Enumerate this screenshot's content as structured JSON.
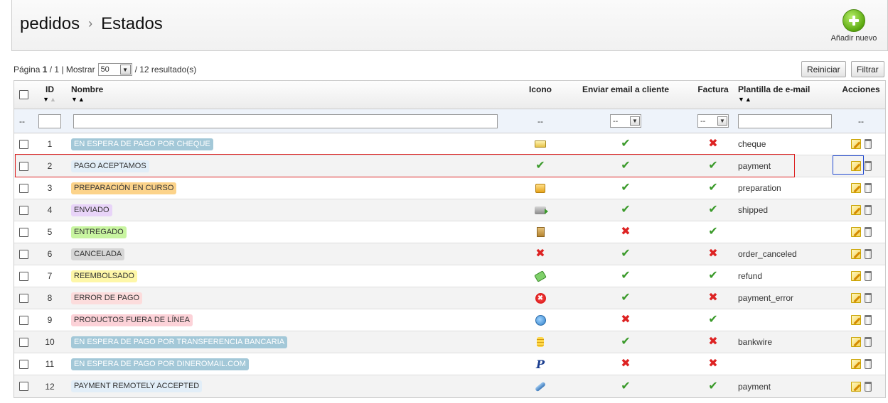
{
  "header": {
    "breadcrumb_root": "pedidos",
    "breadcrumb_sep": "›",
    "breadcrumb_current": "Estados",
    "add_new_label": "Añadir nuevo"
  },
  "pager": {
    "page_label": "Página",
    "page_current": "1",
    "page_total": "/ 1",
    "show_label": "| Mostrar",
    "per_page": "50",
    "results": "/ 12 resultado(s)"
  },
  "buttons": {
    "reset": "Reiniciar",
    "filter": "Filtrar"
  },
  "columns": {
    "id": "ID",
    "name": "Nombre",
    "icon": "Icono",
    "send_email": "Enviar email a cliente",
    "invoice": "Factura",
    "template": "Plantilla de e-mail",
    "actions": "Acciones"
  },
  "filter_row": {
    "dash": "--",
    "select_value": "--"
  },
  "rows": [
    {
      "id": "1",
      "name": "EN ESPERA DE PAGO POR CHEQUE",
      "color": "#a3c8d8",
      "text_color": "#ffffff",
      "icon": "cheque-icon",
      "send_email": true,
      "invoice": false,
      "template": "cheque"
    },
    {
      "id": "2",
      "name": "PAGO ACEPTAMOS",
      "color": "#e2eef8",
      "text_color": "#333333",
      "icon": "check-icon",
      "send_email": true,
      "invoice": true,
      "template": "payment"
    },
    {
      "id": "3",
      "name": "PREPARACIÓN EN CURSO",
      "color": "#fcd38a",
      "text_color": "#333333",
      "icon": "package-icon",
      "send_email": true,
      "invoice": true,
      "template": "preparation"
    },
    {
      "id": "4",
      "name": "ENVIADO",
      "color": "#e8d4f8",
      "text_color": "#333333",
      "icon": "delivery-truck-icon",
      "send_email": true,
      "invoice": true,
      "template": "shipped"
    },
    {
      "id": "5",
      "name": "ENTREGADO",
      "color": "#c8f5a0",
      "text_color": "#333333",
      "icon": "door-icon",
      "send_email": false,
      "invoice": true,
      "template": ""
    },
    {
      "id": "6",
      "name": "CANCELADA",
      "color": "#d6d6d6",
      "text_color": "#333333",
      "icon": "cancel-icon",
      "send_email": true,
      "invoice": false,
      "template": "order_canceled"
    },
    {
      "id": "7",
      "name": "REEMBOLSADO",
      "color": "#fef7a8",
      "text_color": "#333333",
      "icon": "money-icon",
      "send_email": true,
      "invoice": true,
      "template": "refund"
    },
    {
      "id": "8",
      "name": "ERROR DE PAGO",
      "color": "#fcdcdc",
      "text_color": "#333333",
      "icon": "error-icon",
      "send_email": true,
      "invoice": false,
      "template": "payment_error"
    },
    {
      "id": "9",
      "name": "PRODUCTOS FUERA DE LÍNEA",
      "color": "#fcd2d8",
      "text_color": "#333333",
      "icon": "globe-refresh-icon",
      "send_email": false,
      "invoice": true,
      "template": ""
    },
    {
      "id": "10",
      "name": "EN ESPERA DE PAGO POR TRANSFERENCIA BANCARIA",
      "color": "#a3c8d8",
      "text_color": "#ffffff",
      "icon": "coins-icon",
      "send_email": true,
      "invoice": false,
      "template": "bankwire"
    },
    {
      "id": "11",
      "name": "EN ESPERA DE PAGO POR DINEROMAIL.COM",
      "color": "#a3c8d8",
      "text_color": "#ffffff",
      "icon": "paypal-icon",
      "send_email": false,
      "invoice": false,
      "template": ""
    },
    {
      "id": "12",
      "name": "PAYMENT REMOTELY ACCEPTED",
      "color": "#e2eef8",
      "text_color": "#333333",
      "icon": "plug-icon",
      "send_email": true,
      "invoice": true,
      "template": "payment"
    }
  ],
  "glyphs": {
    "yes": "✔",
    "no": "✖",
    "sort_desc": "▼",
    "sort_asc": "▲",
    "select_arrow": "▼",
    "paypal": "P",
    "error": "✖"
  }
}
